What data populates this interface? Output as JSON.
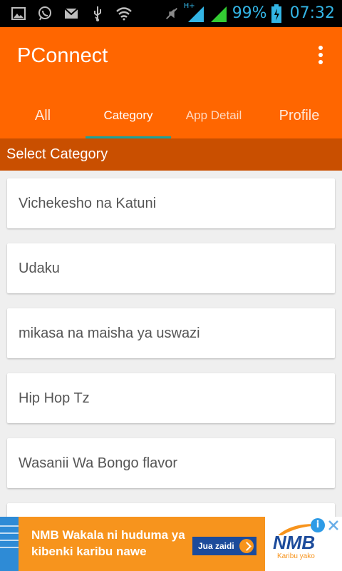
{
  "status_bar": {
    "battery_percent": "99%",
    "time": "07:32",
    "network_type": "H+",
    "icons": [
      "image-icon",
      "whatsapp-icon",
      "gmail-icon",
      "usb-icon",
      "wifi-icon",
      "mute-icon",
      "signal-icon",
      "signal-icon",
      "battery-icon"
    ]
  },
  "app_bar": {
    "title": "PConnect",
    "tabs": [
      {
        "label": "All"
      },
      {
        "label": "Category"
      },
      {
        "label": "App Detail"
      },
      {
        "label": "Profile"
      }
    ],
    "active_tab": "Category",
    "accent_color": "#ff6600",
    "indicator_color": "#1aa39a"
  },
  "section_header": "Select Category",
  "categories": [
    "Vichekesho na Katuni",
    "Udaku",
    "mikasa na maisha ya uswazi",
    "Hip Hop Tz",
    "Wasanii Wa Bongo flavor"
  ],
  "ad": {
    "text": "NMB Wakala ni huduma ya kibenki karibu nawe",
    "cta": "Jua zaidi",
    "brand": "NMB",
    "tagline": "Karibu yako"
  }
}
